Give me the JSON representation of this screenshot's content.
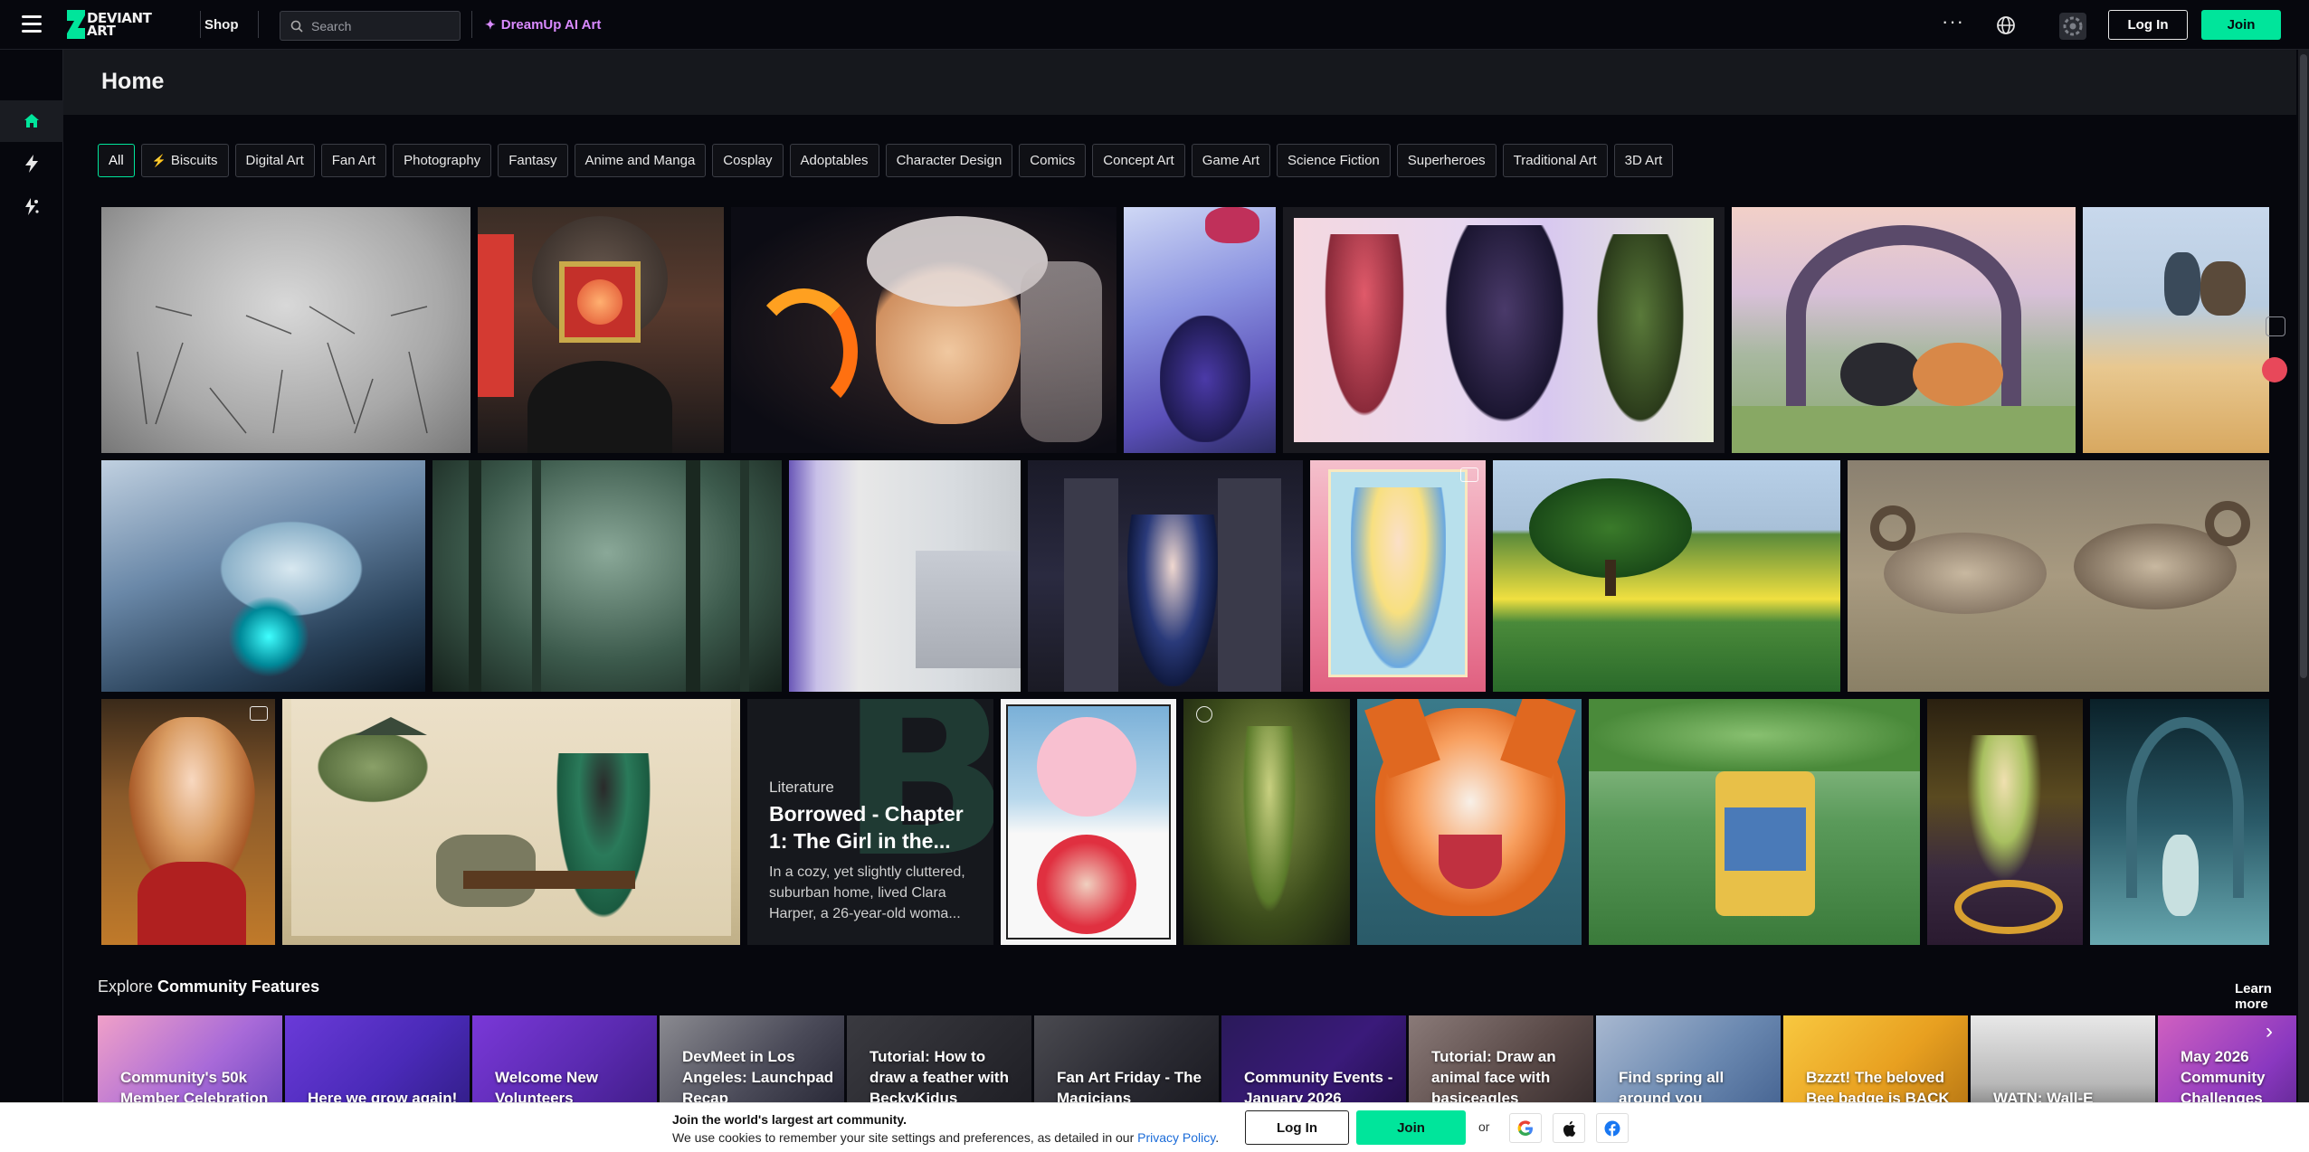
{
  "app": {
    "title": "DeviantArt"
  },
  "header": {
    "logo_text_1": "DEVIANT",
    "logo_text_2": "ART",
    "shop_label": "Shop",
    "search_placeholder": "Search",
    "dreamup_label": "DreamUp AI Art",
    "more_icon": "more-horizontal-icon",
    "globe_icon": "globe-icon",
    "login_label": "Log In",
    "join_label": "Join"
  },
  "sidebar": {
    "items": [
      {
        "name": "home",
        "icon": "home-icon",
        "active": true
      },
      {
        "name": "deviations",
        "icon": "lightning-icon",
        "active": false
      },
      {
        "name": "dreamup",
        "icon": "dreamup-icon",
        "active": false
      }
    ]
  },
  "page": {
    "title": "Home"
  },
  "chips": [
    {
      "label": "All",
      "active": true
    },
    {
      "label": "Biscuits",
      "icon": "lightning-icon"
    },
    {
      "label": "Digital Art"
    },
    {
      "label": "Fan Art"
    },
    {
      "label": "Photography"
    },
    {
      "label": "Fantasy"
    },
    {
      "label": "Anime and Manga"
    },
    {
      "label": "Cosplay"
    },
    {
      "label": "Adoptables"
    },
    {
      "label": "Character Design"
    },
    {
      "label": "Comics"
    },
    {
      "label": "Concept Art"
    },
    {
      "label": "Game Art"
    },
    {
      "label": "Science Fiction"
    },
    {
      "label": "Superheroes"
    },
    {
      "label": "Traditional Art"
    },
    {
      "label": "3D Art"
    }
  ],
  "literature_card": {
    "type": "Literature",
    "title": "Borrowed - Chapter 1: The Girl in the...",
    "excerpt": "In a cozy, yet slightly cluttered, suburban home, lived Clara Harper, a 26-year-old woma..."
  },
  "explore": {
    "prefix": "Explore",
    "title": "Community Features",
    "learn_more": "Learn more",
    "features": [
      {
        "label": "Community's 50k Member Celebration"
      },
      {
        "label": "Here we grow again!"
      },
      {
        "label": "Welcome New Volunteers"
      },
      {
        "label": "DevMeet in Los Angeles: Launchpad Recap"
      },
      {
        "label": "Tutorial: How to draw a feather with BeckyKidus"
      },
      {
        "label": "Fan Art Friday - The Magicians"
      },
      {
        "label": "Community Events - January 2026"
      },
      {
        "label": "Tutorial: Draw an animal face with basiceagles"
      },
      {
        "label": "Find spring all around you"
      },
      {
        "label": "Bzzzt! The beloved Bee badge is BACK"
      },
      {
        "label": "WATN: Wall-E"
      },
      {
        "label": "May 2026 Community Challenges"
      }
    ]
  },
  "cookie": {
    "title": "Join the world's largest art community.",
    "text": "We use cookies to remember your site settings and preferences, as detailed in our",
    "link": "Privacy Policy",
    "end": ".",
    "login_label": "Log In",
    "join_label": "Join",
    "or_label": "or"
  },
  "colors": {
    "accent": "#00e59b",
    "dreamup": "#d98aff",
    "background": "#06070d"
  }
}
